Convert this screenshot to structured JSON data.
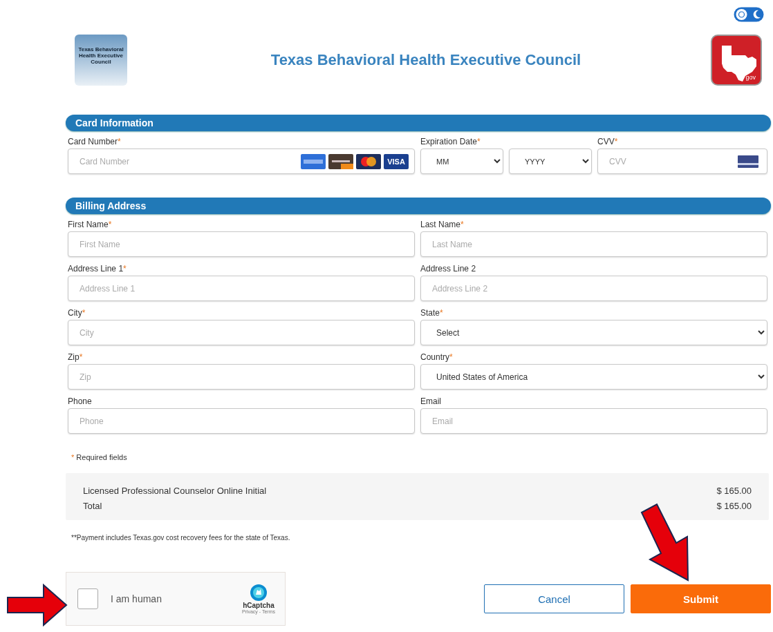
{
  "header": {
    "logo_text": "Texas Behavioral Health Executive Council",
    "title": "Texas Behavioral Health Executive Council",
    "gov_badge": "gov"
  },
  "required_marker": "*",
  "card_section": {
    "title": "Card Information",
    "card_number": {
      "label": "Card Number",
      "required": true,
      "placeholder": "Card Number"
    },
    "card_brands": [
      {
        "kind": "amex"
      },
      {
        "kind": "discover"
      },
      {
        "kind": "mastercard"
      },
      {
        "kind": "visa",
        "label": "VISA"
      }
    ],
    "expiration": {
      "label": "Expiration Date",
      "required": true,
      "month": "MM",
      "year": "YYYY"
    },
    "cvv": {
      "label": "CVV",
      "required": true,
      "placeholder": "CVV"
    }
  },
  "billing_section": {
    "title": "Billing Address",
    "fields": [
      {
        "label": "First Name",
        "required": true,
        "kind": "text",
        "placeholder": "First Name"
      },
      {
        "label": "Last Name",
        "required": true,
        "kind": "text",
        "placeholder": "Last Name"
      },
      {
        "label": "Address Line 1",
        "required": true,
        "kind": "text",
        "placeholder": "Address Line 1"
      },
      {
        "label": "Address Line 2",
        "required": false,
        "kind": "text",
        "placeholder": "Address Line 2"
      },
      {
        "label": "City",
        "required": true,
        "kind": "text",
        "placeholder": "City"
      },
      {
        "label": "State",
        "required": true,
        "kind": "select",
        "value": "Select"
      },
      {
        "label": "Zip",
        "required": true,
        "kind": "text",
        "placeholder": "Zip"
      },
      {
        "label": "Country",
        "required": true,
        "kind": "select",
        "value": "United States of America"
      },
      {
        "label": "Phone",
        "required": false,
        "kind": "text",
        "placeholder": "Phone"
      },
      {
        "label": "Email",
        "required": false,
        "kind": "text",
        "placeholder": "Email"
      }
    ]
  },
  "required_note": "Required fields",
  "summary": [
    {
      "item": "Licensed Professional Counselor Online Initial",
      "amount": "$ 165.00"
    },
    {
      "item": "Total",
      "amount": "$ 165.00"
    }
  ],
  "fee_note": "**Payment includes Texas.gov cost recovery fees for the state of Texas.",
  "captcha": {
    "checked": false,
    "label": "I am human",
    "brand": "hCaptcha",
    "links": "Privacy - Terms"
  },
  "buttons": [
    {
      "label": "Cancel",
      "kind": "secondary"
    },
    {
      "label": "Submit",
      "kind": "primary"
    }
  ]
}
